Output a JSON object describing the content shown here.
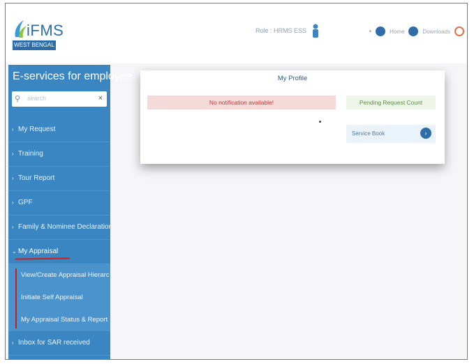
{
  "header": {
    "logo_text": "iFMS",
    "logo_subtext": "WEST BENGAL",
    "role_label": "Role : HRMS ESS",
    "home_label": "Home",
    "downloads_label": "Downloads"
  },
  "sidebar": {
    "title": "E-services for employee",
    "search_placeholder": "search",
    "items": [
      {
        "label": "My Request"
      },
      {
        "label": "Training"
      },
      {
        "label": "Tour Report"
      },
      {
        "label": "GPF"
      },
      {
        "label": "Family & Nominee Declaration"
      },
      {
        "label": "My Appraisal"
      }
    ],
    "subitems": [
      {
        "label": "View/Create Appraisal Hierarc"
      },
      {
        "label": "Initiate Self Appraisal"
      },
      {
        "label": "My Appraisal Status & Report"
      }
    ],
    "after_items": [
      {
        "label": "Inbox for SAR received"
      }
    ]
  },
  "profile": {
    "title": "My Profile",
    "notification": "No notification available!",
    "pending_label": "Pending Request Count",
    "service_book_label": "Service Book"
  },
  "colors": {
    "sidebar": "#3a86c2",
    "brand": "#2f6da8",
    "highlight": "#cc1f1f"
  }
}
